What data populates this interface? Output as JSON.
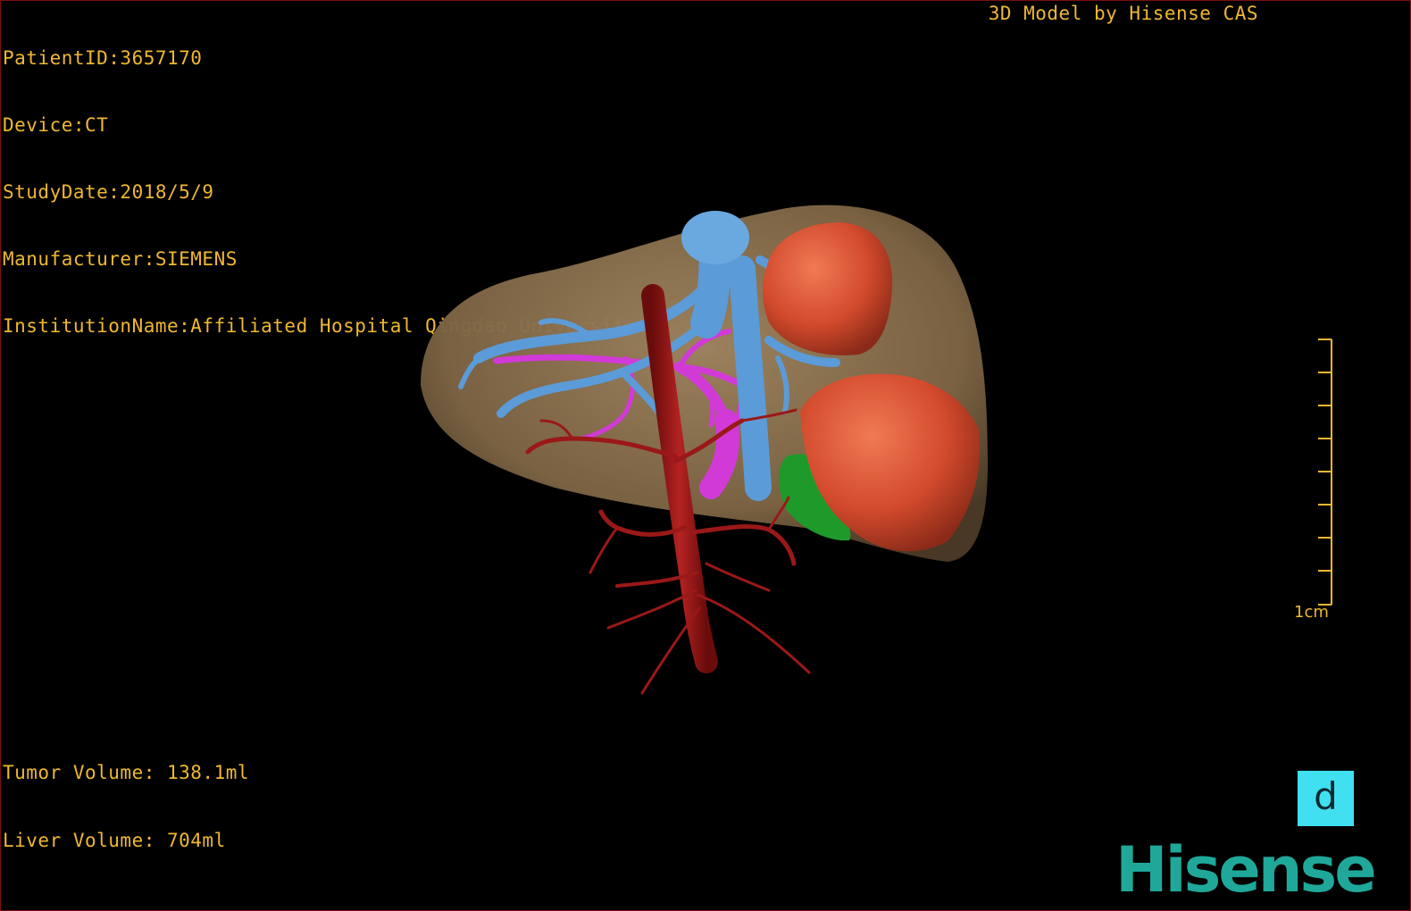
{
  "patient": {
    "id_line": "PatientID:3657170",
    "device_line": "Device:CT",
    "study_date_line": "StudyDate:2018/5/9",
    "manufacturer_line": "Manufacturer:SIEMENS",
    "institution_line": "InstitutionName:Affiliated Hospital Qingdao University-C"
  },
  "credit": "3D Model by Hisense CAS",
  "scale_bar": {
    "label": "1cm",
    "ticks": 8
  },
  "view_badge": "d",
  "volumes": {
    "tumor_line": "Tumor Volume: 138.1ml",
    "liver_line": "Liver Volume: 704ml"
  },
  "logo": "Hisense",
  "colors": {
    "hud_text": "#f0b830",
    "liver": "#8a6e4a",
    "tumor": "#d84a2c",
    "hepatic_vein": "#5b9bd8",
    "portal_vein": "#d23ad8",
    "artery": "#9b1818",
    "gallbladder": "#1e9a2a",
    "badge": "#40e0f0",
    "logo": "#1fa89a"
  },
  "icons": [
    "liver-model-3d",
    "scale-bar",
    "view-orientation-badge",
    "hisense-logo"
  ]
}
